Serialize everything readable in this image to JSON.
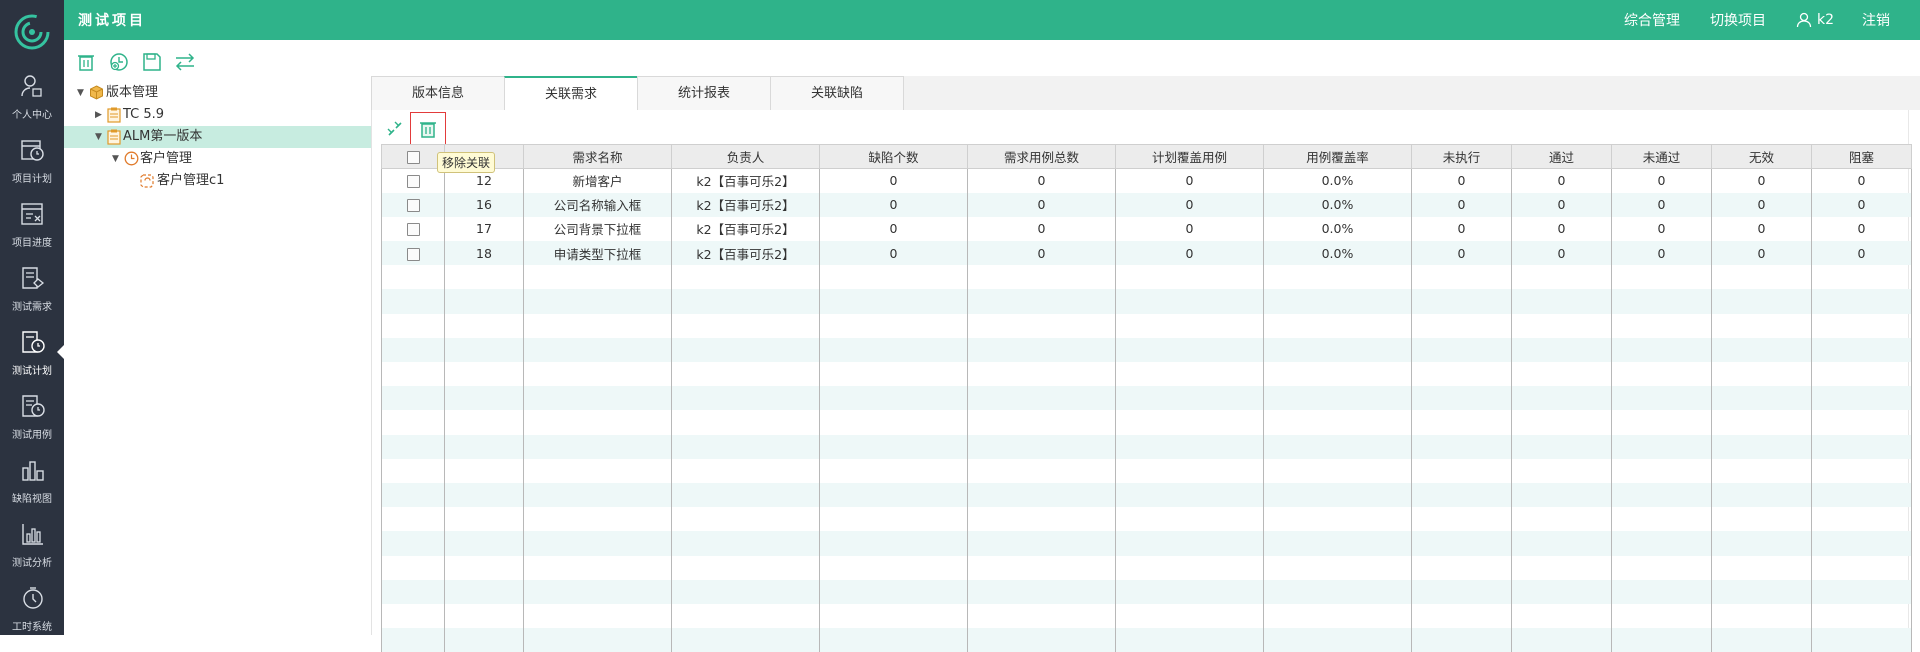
{
  "app": {
    "title": "测试项目"
  },
  "topnav": {
    "manage": "综合管理",
    "switch_project": "切换项目",
    "user": "k2",
    "logout": "注销"
  },
  "sidebar": {
    "items": [
      {
        "label": "个人中心",
        "icon": "person-icon"
      },
      {
        "label": "项目计划",
        "icon": "calendar-clock-icon"
      },
      {
        "label": "项目进度",
        "icon": "progress-icon"
      },
      {
        "label": "测试需求",
        "icon": "requirement-icon"
      },
      {
        "label": "测试计划",
        "icon": "test-plan-icon",
        "active": true
      },
      {
        "label": "测试用例",
        "icon": "test-case-icon"
      },
      {
        "label": "缺陷视图",
        "icon": "defect-icon"
      },
      {
        "label": "测试分析",
        "icon": "analysis-icon"
      },
      {
        "label": "工时系统",
        "icon": "stopwatch-icon"
      }
    ]
  },
  "tree": {
    "root": "版本管理",
    "n1": "TC 5.9",
    "n2": "ALM第一版本",
    "n3": "客户管理",
    "n4": "客户管理c1"
  },
  "tabs": [
    "版本信息",
    "关联需求",
    "统计报表",
    "关联缺陷"
  ],
  "active_tab": "关联需求",
  "tooltip": "移除关联",
  "table": {
    "headers": [
      "",
      "",
      "需求名称",
      "负责人",
      "缺陷个数",
      "需求用例总数",
      "计划覆盖用例",
      "用例覆盖率",
      "未执行",
      "通过",
      "未通过",
      "无效",
      "阻塞"
    ],
    "rows": [
      [
        "12",
        "新增客户",
        "k2【百事可乐2】",
        "0",
        "0",
        "0",
        "0.0%",
        "0",
        "0",
        "0",
        "0",
        "0"
      ],
      [
        "16",
        "公司名称输入框",
        "k2【百事可乐2】",
        "0",
        "0",
        "0",
        "0.0%",
        "0",
        "0",
        "0",
        "0",
        "0"
      ],
      [
        "17",
        "公司背景下拉框",
        "k2【百事可乐2】",
        "0",
        "0",
        "0",
        "0.0%",
        "0",
        "0",
        "0",
        "0",
        "0"
      ],
      [
        "18",
        "申请类型下拉框",
        "k2【百事可乐2】",
        "0",
        "0",
        "0",
        "0.0%",
        "0",
        "0",
        "0",
        "0",
        "0"
      ]
    ]
  },
  "colors": {
    "brand": "#2fb38a",
    "sidebar": "#2c3340",
    "selected_row": "#c7ece0",
    "alt_row": "#eef8f8",
    "highlight_border": "#e23b3b"
  }
}
